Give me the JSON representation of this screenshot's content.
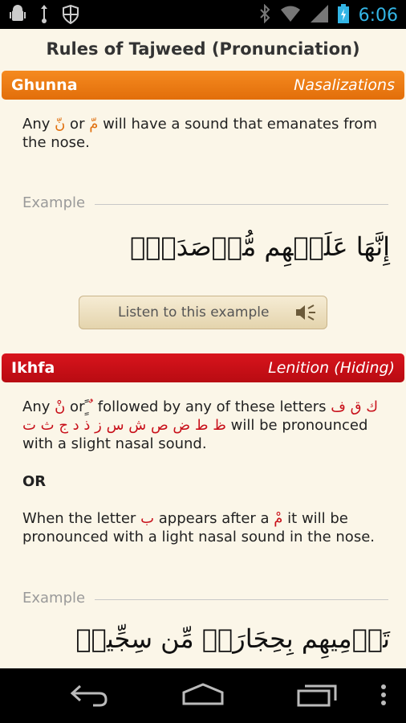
{
  "status_bar": {
    "time": "6:06",
    "left_icons": [
      "android-debug-icon",
      "usb-icon",
      "shield-icon"
    ],
    "right_icons": [
      "bluetooth-icon",
      "wifi-icon",
      "signal-icon",
      "battery-charging-icon"
    ]
  },
  "header": {
    "title": "Rules of Tajweed (Pronunciation)"
  },
  "ghunna": {
    "name": "Ghunna",
    "description": "Nasalizations",
    "body_parts": [
      "Any ",
      "نّ",
      " or ",
      "مّ",
      " will have a sound that emanates from the nose."
    ],
    "example_label": "Example",
    "example_arabic": "إِنَّهَا عَلَيۡهِم مُّؤۡصَدَةُۢ",
    "listen_label": "Listen to this example"
  },
  "ikhfa": {
    "name": "Ikhfa",
    "description": "Lenition (Hiding)",
    "body_1_parts": [
      "Any ",
      "نْ",
      " or ",
      "ًٍ ٌ",
      " followed by any of these letters ",
      "ك ق ف ظ ط ض ص ش س ز ذ د ج ث ت",
      " will be pronounced with a slight nasal sound."
    ],
    "or_label": "OR",
    "body_2_parts": [
      "When the letter ",
      "ب",
      " appears after a ",
      "مْ",
      " it will be pronounced with a light nasal sound in the nose."
    ],
    "example_label": "Example",
    "example_arabic": "تَرۡمِيهِم بِحِجَارَةٖ مِّن سِجِّيلٖ"
  },
  "colors": {
    "orange": "#e0700f",
    "red": "#c8101a",
    "background": "#fbf6e8"
  },
  "nav_icons": [
    "back-icon",
    "home-icon",
    "recent-apps-icon",
    "overflow-menu-icon"
  ]
}
